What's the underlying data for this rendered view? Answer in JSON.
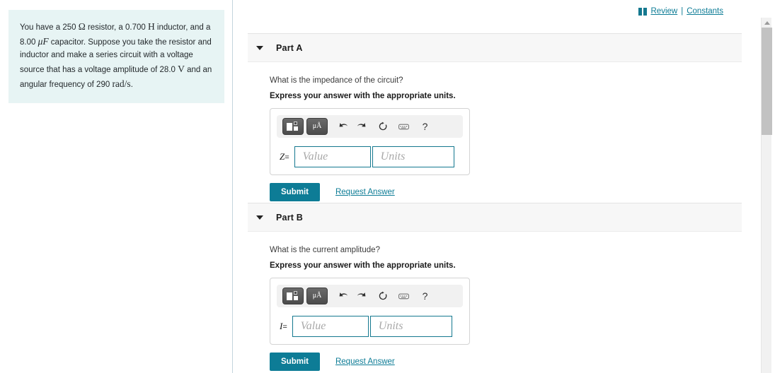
{
  "problem": {
    "segments": [
      {
        "t": "You have a 250 ",
        "k": "p"
      },
      {
        "t": "Ω",
        "k": "sym"
      },
      {
        "t": " resistor, a 0.700 ",
        "k": "p"
      },
      {
        "t": "H",
        "k": "sym"
      },
      {
        "t": " inductor, and a 8.00 ",
        "k": "p"
      },
      {
        "t": "μF",
        "k": "symi"
      },
      {
        "t": " capacitor. Suppose you take the resistor and inductor and make a series circuit with a voltage source that has a voltage amplitude of 28.0 ",
        "k": "p"
      },
      {
        "t": "V",
        "k": "sym"
      },
      {
        "t": " and an angular frequency of 290 ",
        "k": "p"
      },
      {
        "t": "rad/s",
        "k": "sym"
      },
      {
        "t": ".",
        "k": "p"
      }
    ],
    "full_text": "You have a 250 Ω resistor, a 0.700 H inductor, and a 8.00 μF capacitor. Suppose you take the resistor and inductor and make a series circuit with a voltage source that has a voltage amplitude of 28.0 V and an angular frequency of 290 rad/s."
  },
  "topbar": {
    "review_label": "Review",
    "divider": "|",
    "constants_label": "Constants",
    "icon": "book-icon",
    "link_color": "#0d7c96"
  },
  "toolbar_icons": [
    {
      "name": "template-button",
      "label": "template"
    },
    {
      "name": "units-button",
      "label": "μÅ"
    },
    {
      "name": "undo-icon",
      "label": "undo"
    },
    {
      "name": "redo-icon",
      "label": "redo"
    },
    {
      "name": "reset-icon",
      "label": "reset"
    },
    {
      "name": "keyboard-icon",
      "label": "keyboard"
    },
    {
      "name": "help-icon",
      "label": "?"
    }
  ],
  "parts": [
    {
      "id": "part-a",
      "title": "Part A",
      "question": "What is the impedance of the circuit?",
      "instruction": "Express your answer with the appropriate units.",
      "variable": "Z",
      "equals": "=",
      "value_placeholder": "Value",
      "units_placeholder": "Units",
      "value": "",
      "units": "",
      "submit_label": "Submit",
      "request_label": "Request Answer"
    },
    {
      "id": "part-b",
      "title": "Part B",
      "question": "What is the current amplitude?",
      "instruction": "Express your answer with the appropriate units.",
      "variable": "I",
      "equals": "=",
      "value_placeholder": "Value",
      "units_placeholder": "Units",
      "value": "",
      "units": "",
      "submit_label": "Submit",
      "request_label": "Request Answer"
    }
  ],
  "colors": {
    "accent": "#0d7c96",
    "problem_bg": "#e7f4f4",
    "header_bg": "#f7f7f7",
    "field_border": "#14788f"
  }
}
